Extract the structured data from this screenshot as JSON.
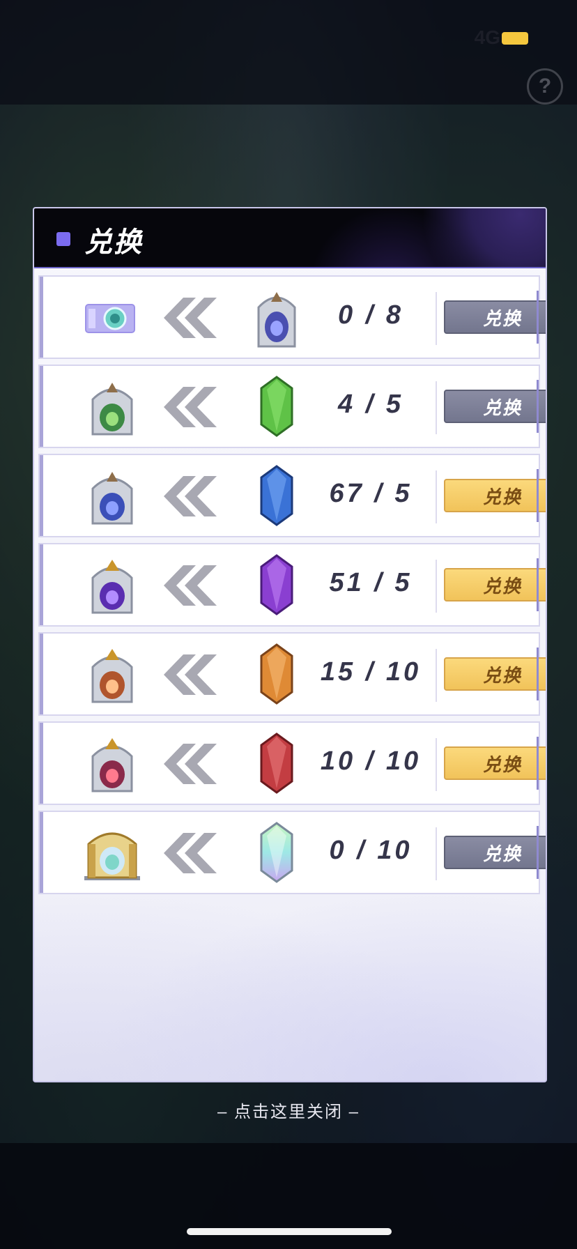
{
  "status_bar": {
    "network": "4G"
  },
  "dialog": {
    "title": "兑换",
    "rows": [
      {
        "source": "ticket-icon",
        "target": "blue-stone-gate-icon",
        "count": "0 / 8",
        "button": "兑换",
        "enabled": false
      },
      {
        "source": "green-gate-icon",
        "target": "green-crystal-icon",
        "count": "4 / 5",
        "button": "兑换",
        "enabled": false
      },
      {
        "source": "blue-gate-icon",
        "target": "blue-crystal-icon",
        "count": "67 / 5",
        "button": "兑换",
        "enabled": true
      },
      {
        "source": "purple-gate-icon",
        "target": "purple-crystal-icon",
        "count": "51 / 5",
        "button": "兑换",
        "enabled": true
      },
      {
        "source": "orange-gate-icon",
        "target": "orange-crystal-icon",
        "count": "15 / 10",
        "button": "兑换",
        "enabled": true
      },
      {
        "source": "red-gate-icon",
        "target": "red-crystal-icon",
        "count": "10 / 10",
        "button": "兑换",
        "enabled": true
      },
      {
        "source": "golden-gate-icon",
        "target": "rainbow-crystal-icon",
        "count": "0 / 10",
        "button": "兑换",
        "enabled": false
      }
    ]
  },
  "close_hint": "– 点击这里关闭 –",
  "colors": {
    "button_enabled": "#f1c35a",
    "button_disabled": "#7f8298",
    "crystal_green": "#5fc247",
    "crystal_blue": "#3a72d6",
    "crystal_purple": "#8a3fd1",
    "crystal_orange": "#df8a35",
    "crystal_red": "#c33d42",
    "accent": "#7b6cf0"
  }
}
